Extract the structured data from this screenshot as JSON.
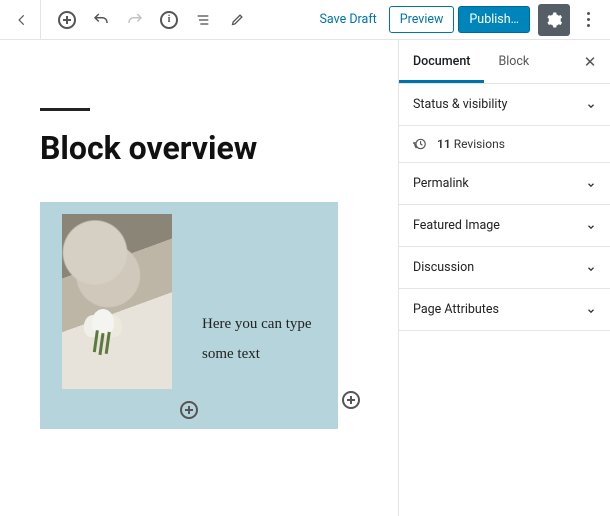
{
  "toolbar": {
    "save_draft": "Save Draft",
    "preview": "Preview",
    "publish": "Publish…"
  },
  "editor": {
    "page_title": "Block overview",
    "block_text": "Here you can type some text"
  },
  "sidebar": {
    "tabs": {
      "document": "Document",
      "block": "Block"
    },
    "panels": {
      "status": "Status & visibility",
      "permalink": "Permalink",
      "featured_image": "Featured Image",
      "discussion": "Discussion",
      "page_attributes": "Page Attributes"
    },
    "revisions": {
      "count": "11",
      "label": "Revisions"
    }
  }
}
